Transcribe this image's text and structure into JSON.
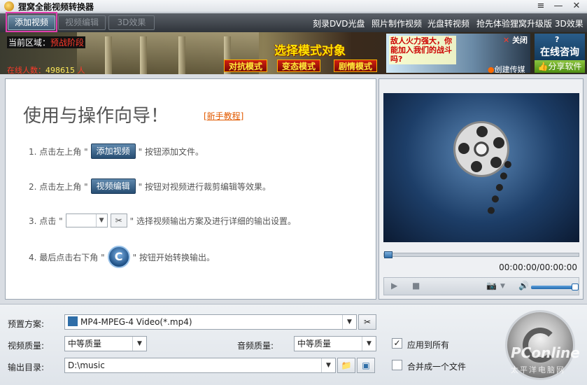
{
  "window": {
    "title": "狸窝全能视频转换器",
    "menu_icon": "≡",
    "minimize_icon": "—",
    "close_icon": "✕"
  },
  "toolbar": {
    "add_video": "添加视频",
    "edit_video": "视频编辑",
    "effect_3d": "3D效果",
    "links": [
      "刻录DVD光盘",
      "照片制作视频",
      "光盘转视频",
      "抢先体验狸窝升级版 3D效果"
    ]
  },
  "banner": {
    "region_label": "当前区域：",
    "region_value": "预战阶段",
    "online_label": "在线人数：",
    "online_value": "498615",
    "online_unit": "人",
    "mode_title": "选择模式对象",
    "modes": [
      "对抗模式",
      "变态模式",
      "剧情模式"
    ],
    "ad_text": "敌人火力强大，你能加入我们的战斗吗?",
    "ad_close": "关闭",
    "ad_create": "创建传媒",
    "consult": "在线咨询",
    "share": "分享软件"
  },
  "guide": {
    "heading": "使用与操作向导！",
    "tutorial_link": "[新手教程]",
    "step1_prefix": "1. 点击左上角 \"",
    "step1_chip": "添加视频",
    "step1_suffix": "\" 按钮添加文件。",
    "step2_prefix": "2. 点击左上角 \"",
    "step2_chip": "视频编辑",
    "step2_suffix": "\" 按钮对视频进行裁剪编辑等效果。",
    "step3_prefix": "3. 点击 \"",
    "step3_suffix": "\" 选择视频输出方案及进行详细的输出设置。",
    "step4_prefix": "4. 最后点击右下角 \"",
    "step4_suffix": "\" 按钮开始转换输出。"
  },
  "player": {
    "timecode": "00:00:00/00:00:00",
    "progress": 0,
    "volume": 1.0
  },
  "settings": {
    "preset_label": "预置方案:",
    "preset_value": "MP4-MPEG-4 Video(*.mp4)",
    "video_quality_label": "视频质量:",
    "video_quality_value": "中等质量",
    "audio_quality_label": "音频质量:",
    "audio_quality_value": "中等质量",
    "apply_all_label": "应用到所有",
    "apply_all_checked": true,
    "output_label": "输出目录:",
    "output_value": "D:\\music",
    "merge_label": "合并成一个文件",
    "merge_checked": false
  },
  "watermark": {
    "brand": "PConline",
    "sub": "太平洋电脑网"
  },
  "colors": {
    "highlight": "#e23fb0",
    "chip_blue": "#274e73",
    "tutorial_orange": "#e25a00"
  }
}
